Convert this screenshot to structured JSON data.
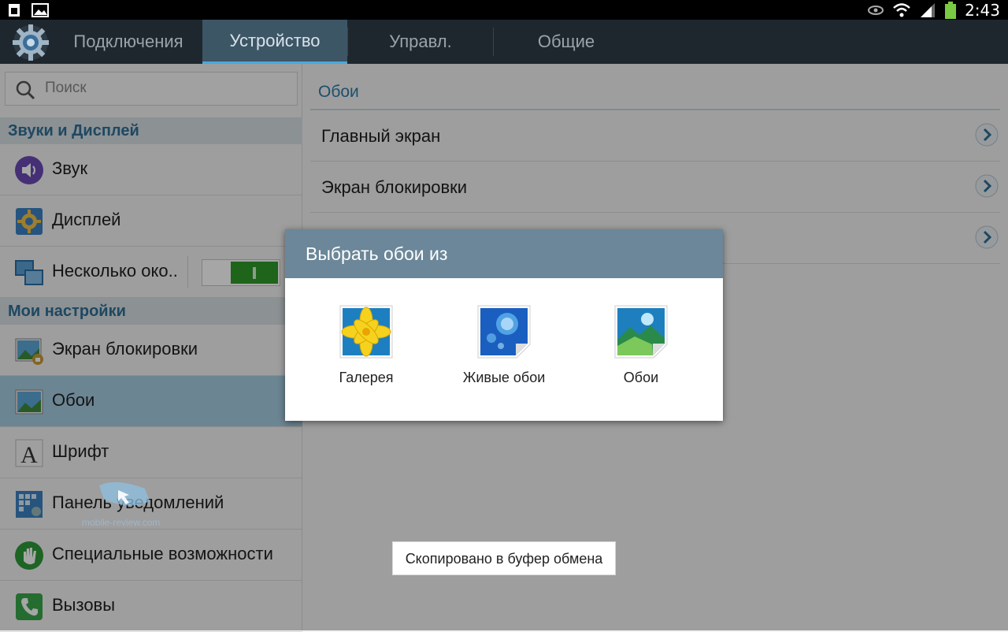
{
  "status_bar": {
    "time": "2:43",
    "icons": [
      "sim-card-icon",
      "image-icon",
      "eye-icon",
      "wifi-icon",
      "signal-icon",
      "battery-icon"
    ],
    "battery_color": "#7ac943"
  },
  "tabs": [
    {
      "label": "Подключения",
      "active": false
    },
    {
      "label": "Устройство",
      "active": true
    },
    {
      "label": "Управл.",
      "active": false
    },
    {
      "label": "Общие",
      "active": false
    }
  ],
  "search": {
    "placeholder": "Поиск"
  },
  "sidebar": {
    "section1": "Звуки и Дисплей",
    "section2": "Мои настройки",
    "items": [
      {
        "label": "Звук",
        "icon": "speaker-icon"
      },
      {
        "label": "Дисплей",
        "icon": "display-gear-icon"
      },
      {
        "label": "Несколько око..",
        "icon": "multi-window-icon",
        "toggle": "on"
      },
      {
        "label": "Экран блокировки",
        "icon": "lock-screen-icon"
      },
      {
        "label": "Обои",
        "icon": "wallpaper-icon",
        "selected": true
      },
      {
        "label": "Шрифт",
        "icon": "font-icon"
      },
      {
        "label": "Панель уведомлений",
        "icon": "notification-panel-icon"
      },
      {
        "label": "Специальные возможности",
        "icon": "hand-icon"
      },
      {
        "label": "Вызовы",
        "icon": "phone-icon"
      }
    ]
  },
  "content": {
    "title": "Обои",
    "rows": [
      {
        "label": "Главный экран"
      },
      {
        "label": "Экран блокировки"
      },
      {
        "label": ""
      }
    ]
  },
  "dialog": {
    "title": "Выбрать обои из",
    "options": [
      {
        "label": "Галерея",
        "icon": "gallery-flower-icon"
      },
      {
        "label": "Живые обои",
        "icon": "live-wallpaper-icon"
      },
      {
        "label": "Обои",
        "icon": "wallpaper-landscape-icon"
      }
    ]
  },
  "watermark": {
    "text": "mobile-review.com"
  },
  "toast": {
    "text": "Скопировано в буфер обмена"
  },
  "colors": {
    "accent": "#2e7aa8",
    "header": "#6b8799",
    "selected": "#a6cde2",
    "toggle": "#2f9a2a"
  }
}
